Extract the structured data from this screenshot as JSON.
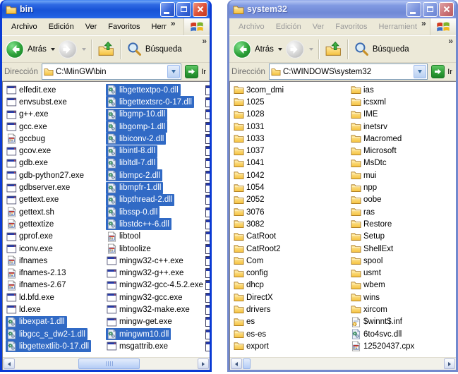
{
  "left_window": {
    "title": "bin",
    "state": "active",
    "menu": [
      "Archivo",
      "Edición",
      "Ver",
      "Favoritos",
      "Herr"
    ],
    "menu_overflow": "»",
    "toolbar": {
      "back_label": "Atrás",
      "search_label": "Búsqueda",
      "overflow": "»"
    },
    "address": {
      "label": "Dirección",
      "path": "C:\\MinGW\\bin",
      "go_label": "Ir"
    },
    "clipped_rows": 22,
    "scrollbar": {
      "orientation": "horizontal",
      "thumb_position": "center"
    },
    "columns": [
      [
        {
          "name": "elfedit.exe",
          "type": "exe",
          "selected": false
        },
        {
          "name": "envsubst.exe",
          "type": "exe",
          "selected": false
        },
        {
          "name": "g++.exe",
          "type": "exe",
          "selected": false
        },
        {
          "name": "gcc.exe",
          "type": "exe",
          "selected": false
        },
        {
          "name": "gccbug",
          "type": "script",
          "selected": false
        },
        {
          "name": "gcov.exe",
          "type": "exe",
          "selected": false
        },
        {
          "name": "gdb.exe",
          "type": "exe",
          "selected": false
        },
        {
          "name": "gdb-python27.exe",
          "type": "exe",
          "selected": false
        },
        {
          "name": "gdbserver.exe",
          "type": "exe",
          "selected": false
        },
        {
          "name": "gettext.exe",
          "type": "exe",
          "selected": false
        },
        {
          "name": "gettext.sh",
          "type": "script",
          "selected": false
        },
        {
          "name": "gettextize",
          "type": "script",
          "selected": false
        },
        {
          "name": "gprof.exe",
          "type": "exe",
          "selected": false
        },
        {
          "name": "iconv.exe",
          "type": "exe",
          "selected": false
        },
        {
          "name": "ifnames",
          "type": "script",
          "selected": false
        },
        {
          "name": "ifnames-2.13",
          "type": "script",
          "selected": false
        },
        {
          "name": "ifnames-2.67",
          "type": "script",
          "selected": false
        },
        {
          "name": "ld.bfd.exe",
          "type": "exe",
          "selected": false
        },
        {
          "name": "ld.exe",
          "type": "exe",
          "selected": false
        },
        {
          "name": "libexpat-1.dll",
          "type": "dll",
          "selected": true
        },
        {
          "name": "libgcc_s_dw2-1.dll",
          "type": "dll",
          "selected": true
        },
        {
          "name": "libgettextlib-0-17.dll",
          "type": "dll",
          "selected": true
        }
      ],
      [
        {
          "name": "libgettextpo-0.dll",
          "type": "dll",
          "selected": true
        },
        {
          "name": "libgettextsrc-0-17.dll",
          "type": "dll",
          "selected": true
        },
        {
          "name": "libgmp-10.dll",
          "type": "dll",
          "selected": true
        },
        {
          "name": "libgomp-1.dll",
          "type": "dll",
          "selected": true
        },
        {
          "name": "libiconv-2.dll",
          "type": "dll",
          "selected": true
        },
        {
          "name": "libintl-8.dll",
          "type": "dll",
          "selected": true
        },
        {
          "name": "libltdl-7.dll",
          "type": "dll",
          "selected": true
        },
        {
          "name": "libmpc-2.dll",
          "type": "dll",
          "selected": true
        },
        {
          "name": "libmpfr-1.dll",
          "type": "dll",
          "selected": true
        },
        {
          "name": "libpthread-2.dll",
          "type": "dll",
          "selected": true
        },
        {
          "name": "libssp-0.dll",
          "type": "dll",
          "selected": true
        },
        {
          "name": "libstdc++-6.dll",
          "type": "dll",
          "selected": true
        },
        {
          "name": "libtool",
          "type": "script",
          "selected": false
        },
        {
          "name": "libtoolize",
          "type": "script",
          "selected": false
        },
        {
          "name": "mingw32-c++.exe",
          "type": "exe",
          "selected": false
        },
        {
          "name": "mingw32-g++.exe",
          "type": "exe",
          "selected": false
        },
        {
          "name": "mingw32-gcc-4.5.2.exe",
          "type": "exe",
          "selected": false
        },
        {
          "name": "mingw32-gcc.exe",
          "type": "exe",
          "selected": false
        },
        {
          "name": "mingw32-make.exe",
          "type": "exe",
          "selected": false
        },
        {
          "name": "mingw-get.exe",
          "type": "exe",
          "selected": false
        },
        {
          "name": "mingwm10.dll",
          "type": "dll",
          "selected": true
        },
        {
          "name": "msgattrib.exe",
          "type": "exe",
          "selected": false
        }
      ]
    ]
  },
  "right_window": {
    "title": "system32",
    "state": "inactive",
    "menu": [
      "Archivo",
      "Edición",
      "Ver",
      "Favoritos",
      "Herramient"
    ],
    "menu_overflow": "»",
    "toolbar": {
      "back_label": "Atrás",
      "search_label": "Búsqueda",
      "overflow": "»"
    },
    "address": {
      "label": "Dirección",
      "path": "C:\\WINDOWS\\system32",
      "go_label": "Ir"
    },
    "clipped_rows": 0,
    "scrollbar": {
      "orientation": "horizontal",
      "thumb_position": "left"
    },
    "columns": [
      [
        {
          "name": "3com_dmi",
          "type": "folder",
          "selected": false
        },
        {
          "name": "1025",
          "type": "folder",
          "selected": false
        },
        {
          "name": "1028",
          "type": "folder",
          "selected": false
        },
        {
          "name": "1031",
          "type": "folder",
          "selected": false
        },
        {
          "name": "1033",
          "type": "folder",
          "selected": false
        },
        {
          "name": "1037",
          "type": "folder",
          "selected": false
        },
        {
          "name": "1041",
          "type": "folder",
          "selected": false
        },
        {
          "name": "1042",
          "type": "folder",
          "selected": false
        },
        {
          "name": "1054",
          "type": "folder",
          "selected": false
        },
        {
          "name": "2052",
          "type": "folder",
          "selected": false
        },
        {
          "name": "3076",
          "type": "folder",
          "selected": false
        },
        {
          "name": "3082",
          "type": "folder",
          "selected": false
        },
        {
          "name": "CatRoot",
          "type": "folder",
          "selected": false
        },
        {
          "name": "CatRoot2",
          "type": "folder",
          "selected": false
        },
        {
          "name": "Com",
          "type": "folder",
          "selected": false
        },
        {
          "name": "config",
          "type": "folder",
          "selected": false
        },
        {
          "name": "dhcp",
          "type": "folder",
          "selected": false
        },
        {
          "name": "DirectX",
          "type": "folder",
          "selected": false
        },
        {
          "name": "drivers",
          "type": "folder",
          "selected": false
        },
        {
          "name": "es",
          "type": "folder",
          "selected": false
        },
        {
          "name": "es-es",
          "type": "folder",
          "selected": false
        },
        {
          "name": "export",
          "type": "folder",
          "selected": false
        }
      ],
      [
        {
          "name": "ias",
          "type": "folder",
          "selected": false
        },
        {
          "name": "icsxml",
          "type": "folder",
          "selected": false
        },
        {
          "name": "IME",
          "type": "folder",
          "selected": false
        },
        {
          "name": "inetsrv",
          "type": "folder",
          "selected": false
        },
        {
          "name": "Macromed",
          "type": "folder",
          "selected": false
        },
        {
          "name": "Microsoft",
          "type": "folder",
          "selected": false
        },
        {
          "name": "MsDtc",
          "type": "folder",
          "selected": false
        },
        {
          "name": "mui",
          "type": "folder",
          "selected": false
        },
        {
          "name": "npp",
          "type": "folder",
          "selected": false
        },
        {
          "name": "oobe",
          "type": "folder",
          "selected": false
        },
        {
          "name": "ras",
          "type": "folder",
          "selected": false
        },
        {
          "name": "Restore",
          "type": "folder",
          "selected": false
        },
        {
          "name": "Setup",
          "type": "folder",
          "selected": false
        },
        {
          "name": "ShellExt",
          "type": "folder",
          "selected": false
        },
        {
          "name": "spool",
          "type": "folder",
          "selected": false
        },
        {
          "name": "usmt",
          "type": "folder",
          "selected": false
        },
        {
          "name": "wbem",
          "type": "folder",
          "selected": false
        },
        {
          "name": "wins",
          "type": "folder",
          "selected": false
        },
        {
          "name": "xircom",
          "type": "folder",
          "selected": false
        },
        {
          "name": "$winnt$.inf",
          "type": "inf",
          "selected": false
        },
        {
          "name": "6to4svc.dll",
          "type": "dll",
          "selected": false
        },
        {
          "name": "12520437.cpx",
          "type": "script",
          "selected": false
        }
      ]
    ]
  },
  "icons": {
    "folder-icon": "yellow folder",
    "exe-icon": "application window",
    "dll-icon": "page with gears",
    "script-icon": "page with mini table",
    "inf-icon": "page with yellow gear",
    "back-icon": "green circle left arrow",
    "forward-icon": "gray circle right arrow",
    "up-icon": "folder with green up arrow",
    "search-icon": "magnifier",
    "windows-logo": "four color flag"
  },
  "colors": {
    "active_border": "#0a3ad4",
    "inactive_border": "#7289ce",
    "selection_blue": "#316ac5",
    "chrome_face": "#ece9d8",
    "go_button_green": "#2f9e36",
    "back_button_green": "#2ea23a",
    "close_button_red": "#dd4f35"
  }
}
